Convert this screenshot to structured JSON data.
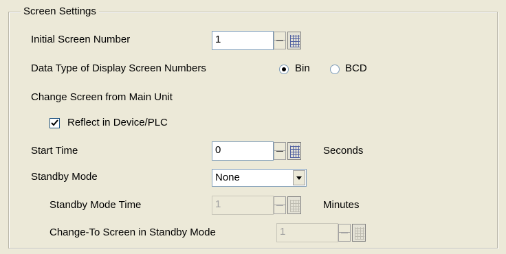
{
  "group": {
    "title": "Screen Settings"
  },
  "initial_screen": {
    "label": "Initial Screen Number",
    "value": "1"
  },
  "data_type": {
    "label": "Data Type of Display Screen Numbers",
    "options": [
      "Bin",
      "BCD"
    ],
    "selected": "Bin"
  },
  "change_screen": {
    "label": "Change Screen from Main Unit"
  },
  "reflect": {
    "label": "Reflect in Device/PLC",
    "checked": true
  },
  "start_time": {
    "label": "Start Time",
    "value": "0",
    "unit": "Seconds"
  },
  "standby_mode": {
    "label": "Standby Mode",
    "value": "None"
  },
  "standby_time": {
    "label": "Standby Mode Time",
    "value": "1",
    "unit": "Minutes"
  },
  "change_to_screen": {
    "label": "Change-To Screen in Standby Mode",
    "value": "1"
  }
}
